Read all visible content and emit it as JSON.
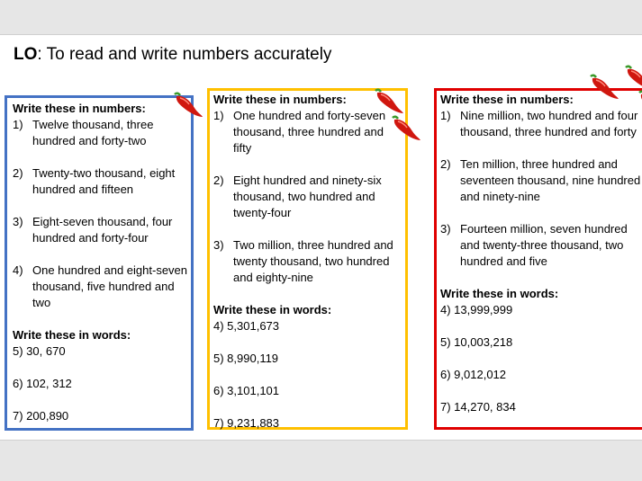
{
  "lesson": {
    "lo_prefix": "LO",
    "lo_text": ": To read and write numbers accurately"
  },
  "colors": {
    "blue": "#4472c4",
    "yellow": "#ffc000",
    "red": "#e00000",
    "chilli": "#d0170f",
    "stem": "#3a9a2a"
  },
  "icons": {
    "difficulty": "chilli-pepper-icon"
  },
  "blue_box": {
    "numbers_heading": "Write these in numbers:",
    "numbers": [
      {
        "n": "1)",
        "text": "Twelve thousand, three hundred and forty-two"
      },
      {
        "n": "2)",
        "text": "Twenty-two thousand, eight hundred and fifteen"
      },
      {
        "n": "3)",
        "text": "Eight-seven thousand, four hundred and forty-four"
      },
      {
        "n": "4)",
        "text": "One hundred and eight-seven thousand, five hundred and two"
      }
    ],
    "words_heading": "Write these in words:",
    "words": [
      "5) 30, 670",
      "6) 102, 312",
      "7) 200,890"
    ]
  },
  "yellow_box": {
    "numbers_heading": "Write these in numbers:",
    "numbers": [
      {
        "n": "1)",
        "text": "One hundred and forty-seven thousand, three hundred and fifty"
      },
      {
        "n": "2)",
        "text": "Eight hundred and ninety-six thousand, two hundred and twenty-four"
      },
      {
        "n": "3)",
        "text": "Two million, three hundred and twenty thousand, two hundred and eighty-nine"
      }
    ],
    "words_heading": "Write these in words:",
    "words": [
      "4) 5,301,673",
      "5) 8,990,119",
      "6) 3,101,101",
      "7) 9,231,883"
    ]
  },
  "red_box": {
    "numbers_heading": "Write these in numbers:",
    "numbers": [
      {
        "n": "1)",
        "text": "Nine million, two hundred and four thousand, three hundred and forty"
      },
      {
        "n": "2)",
        "text": "Ten million, three hundred and seventeen thousand, nine hundred and ninety-nine"
      },
      {
        "n": "3)",
        "text": "Fourteen million, seven hundred and twenty-three thousand, two hundred and five"
      }
    ],
    "words_heading": "Write these in words:",
    "words": [
      "4) 13,999,999",
      "5) 10,003,218",
      "6) 9,012,012",
      "7) 14,270, 834"
    ]
  }
}
